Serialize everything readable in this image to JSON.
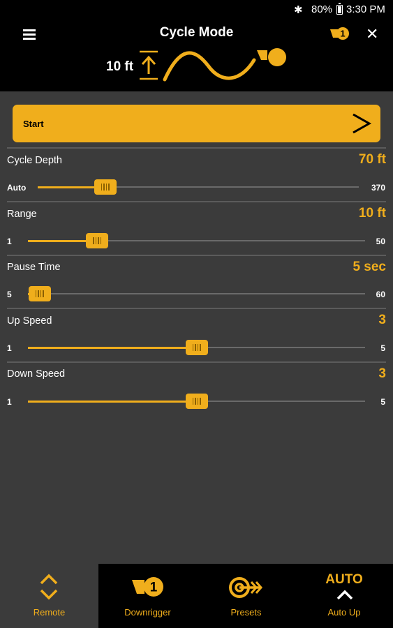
{
  "status_bar": {
    "battery": "80%",
    "time": "3:30 PM"
  },
  "header": {
    "title": "Cycle Mode",
    "range_display": "10 ft",
    "downrigger_badge": "1"
  },
  "start_button": {
    "label": "Start"
  },
  "sliders": [
    {
      "label": "Cycle Depth",
      "value": "70 ft",
      "min_label": "Auto",
      "max_label": "370",
      "fraction": 0.21
    },
    {
      "label": "Range",
      "value": "10 ft",
      "min_label": "1",
      "max_label": "50",
      "fraction": 0.205
    },
    {
      "label": "Pause Time",
      "value": "5 sec",
      "min_label": "5",
      "max_label": "60",
      "fraction": 0.035
    },
    {
      "label": "Up Speed",
      "value": "3",
      "min_label": "1",
      "max_label": "5",
      "fraction": 0.5
    },
    {
      "label": "Down Speed",
      "value": "3",
      "min_label": "1",
      "max_label": "5",
      "fraction": 0.5
    }
  ],
  "bottom_nav": {
    "remote": "Remote",
    "downrigger": "Downrigger",
    "downrigger_badge": "1",
    "presets": "Presets",
    "auto_up_top": "AUTO",
    "auto_up": "Auto Up"
  },
  "colors": {
    "accent": "#f0ae1c",
    "background": "#3b3b3b",
    "bar": "#000000"
  }
}
